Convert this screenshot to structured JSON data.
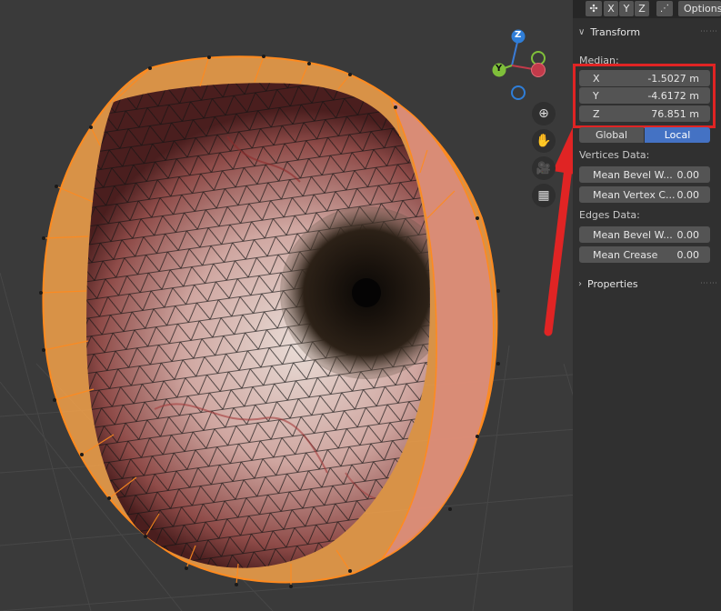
{
  "header": {
    "axis_buttons": [
      "X",
      "Y",
      "Z"
    ],
    "options_label": "Options"
  },
  "transform": {
    "title": "Transform",
    "median_label": "Median:",
    "x_label": "X",
    "x_value": "-1.5027 m",
    "y_label": "Y",
    "y_value": "-4.6172 m",
    "z_label": "Z",
    "z_value": "76.851 m",
    "global_label": "Global",
    "local_label": "Local"
  },
  "vertices": {
    "title": "Vertices Data:",
    "bevel_label": "Mean Bevel W...",
    "bevel_value": "0.00",
    "crease_label": "Mean Vertex C...",
    "crease_value": "0.00"
  },
  "edges": {
    "title": "Edges Data:",
    "bevel_label": "Mean Bevel W...",
    "bevel_value": "0.00",
    "crease_label": "Mean Crease",
    "crease_value": "0.00"
  },
  "properties": {
    "title": "Properties"
  },
  "gizmo": {
    "z": "Z",
    "y": "Y"
  },
  "colors": {
    "selection": "#f28c28",
    "active": "#4472c4",
    "annotation": "#e02424"
  }
}
